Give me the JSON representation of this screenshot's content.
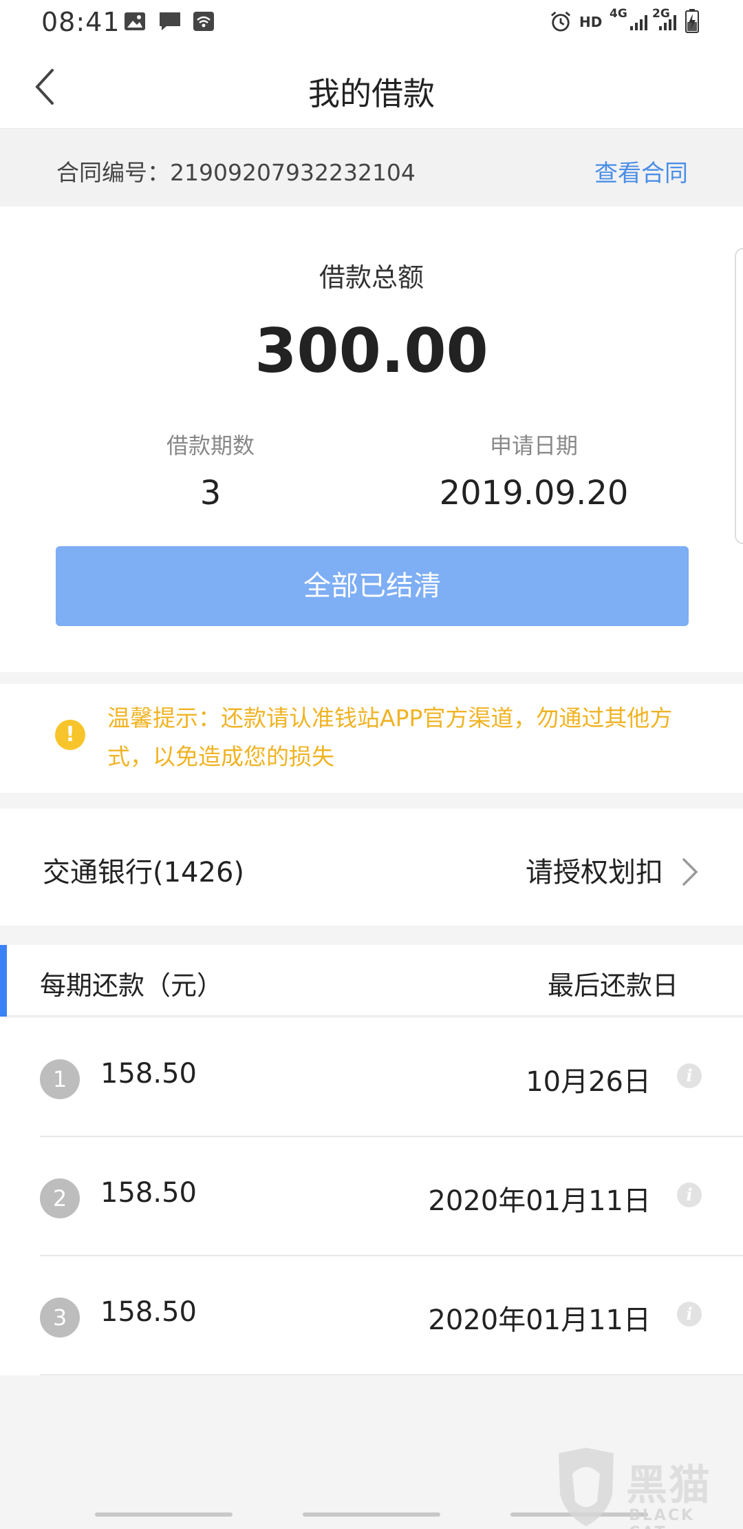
{
  "status_bar": {
    "time": "08:41",
    "network_labels": [
      "HD",
      "4G",
      "2G"
    ]
  },
  "nav": {
    "title": "我的借款"
  },
  "contract": {
    "label": "合同编号：21909207932232104",
    "link": "查看合同"
  },
  "summary": {
    "total_label": "借款总额",
    "total_amount": "300.00",
    "periods_label": "借款期数",
    "periods_value": "3",
    "apply_date_label": "申请日期",
    "apply_date_value": "2019.09.20",
    "status_button": "全部已结清"
  },
  "notice": {
    "text": "温馨提示：还款请认准钱站APP官方渠道，勿通过其他方式，以免造成您的损失"
  },
  "bank": {
    "name": "交通银行(1426)",
    "action": "请授权划扣"
  },
  "schedule": {
    "col_left": "每期还款（元）",
    "col_right": "最后还款日",
    "rows": [
      {
        "num": "1",
        "amount": "158.50",
        "date": "10月26日"
      },
      {
        "num": "2",
        "amount": "158.50",
        "date": "2020年01月11日"
      },
      {
        "num": "3",
        "amount": "158.50",
        "date": "2020年01月11日"
      }
    ]
  },
  "watermark": {
    "text": "黑猫",
    "sub": "BLACK CAT"
  },
  "colors": {
    "accent": "#3b82f6",
    "link": "#4a8ee5",
    "button": "#7eaef4",
    "warning": "#f0b323"
  }
}
